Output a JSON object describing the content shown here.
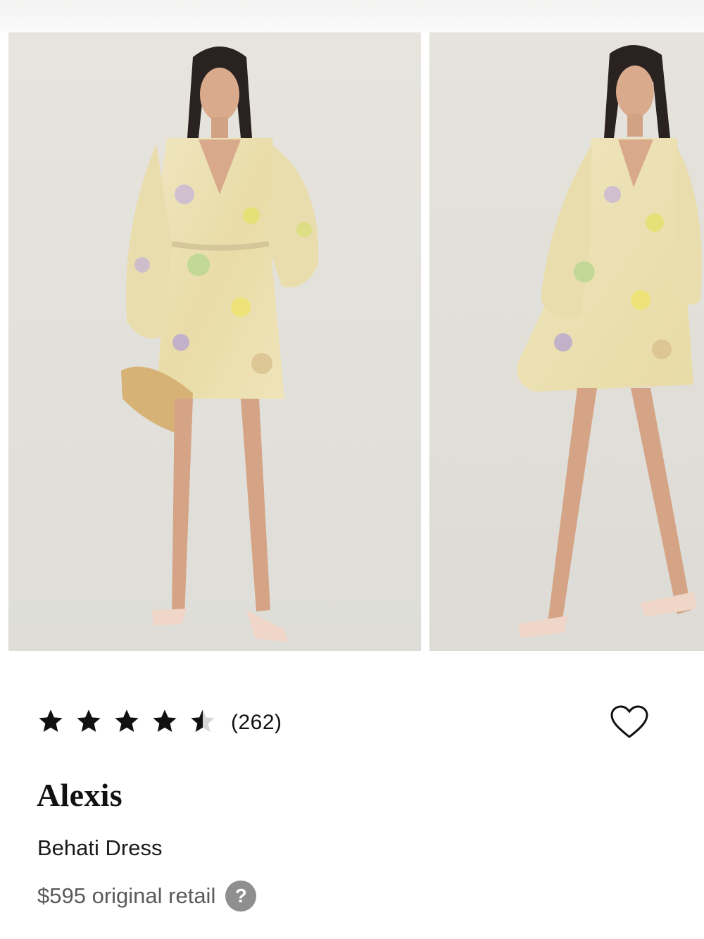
{
  "product": {
    "rating_stars": 4.5,
    "rating_count": "(262)",
    "brand": "Alexis",
    "name": "Behati Dress",
    "price": "$595 original retail",
    "help_icon_glyph": "?"
  },
  "icons": {
    "star": "star-icon",
    "heart": "heart-icon",
    "help": "question-mark-icon"
  },
  "colors": {
    "text": "#111111",
    "muted": "#5a5a5a",
    "star_filled": "#111111",
    "star_empty": "#d6d6d6",
    "photo_background": "#e6e3dd",
    "dress": "#eee3b4",
    "skin": "#d8a98a"
  }
}
